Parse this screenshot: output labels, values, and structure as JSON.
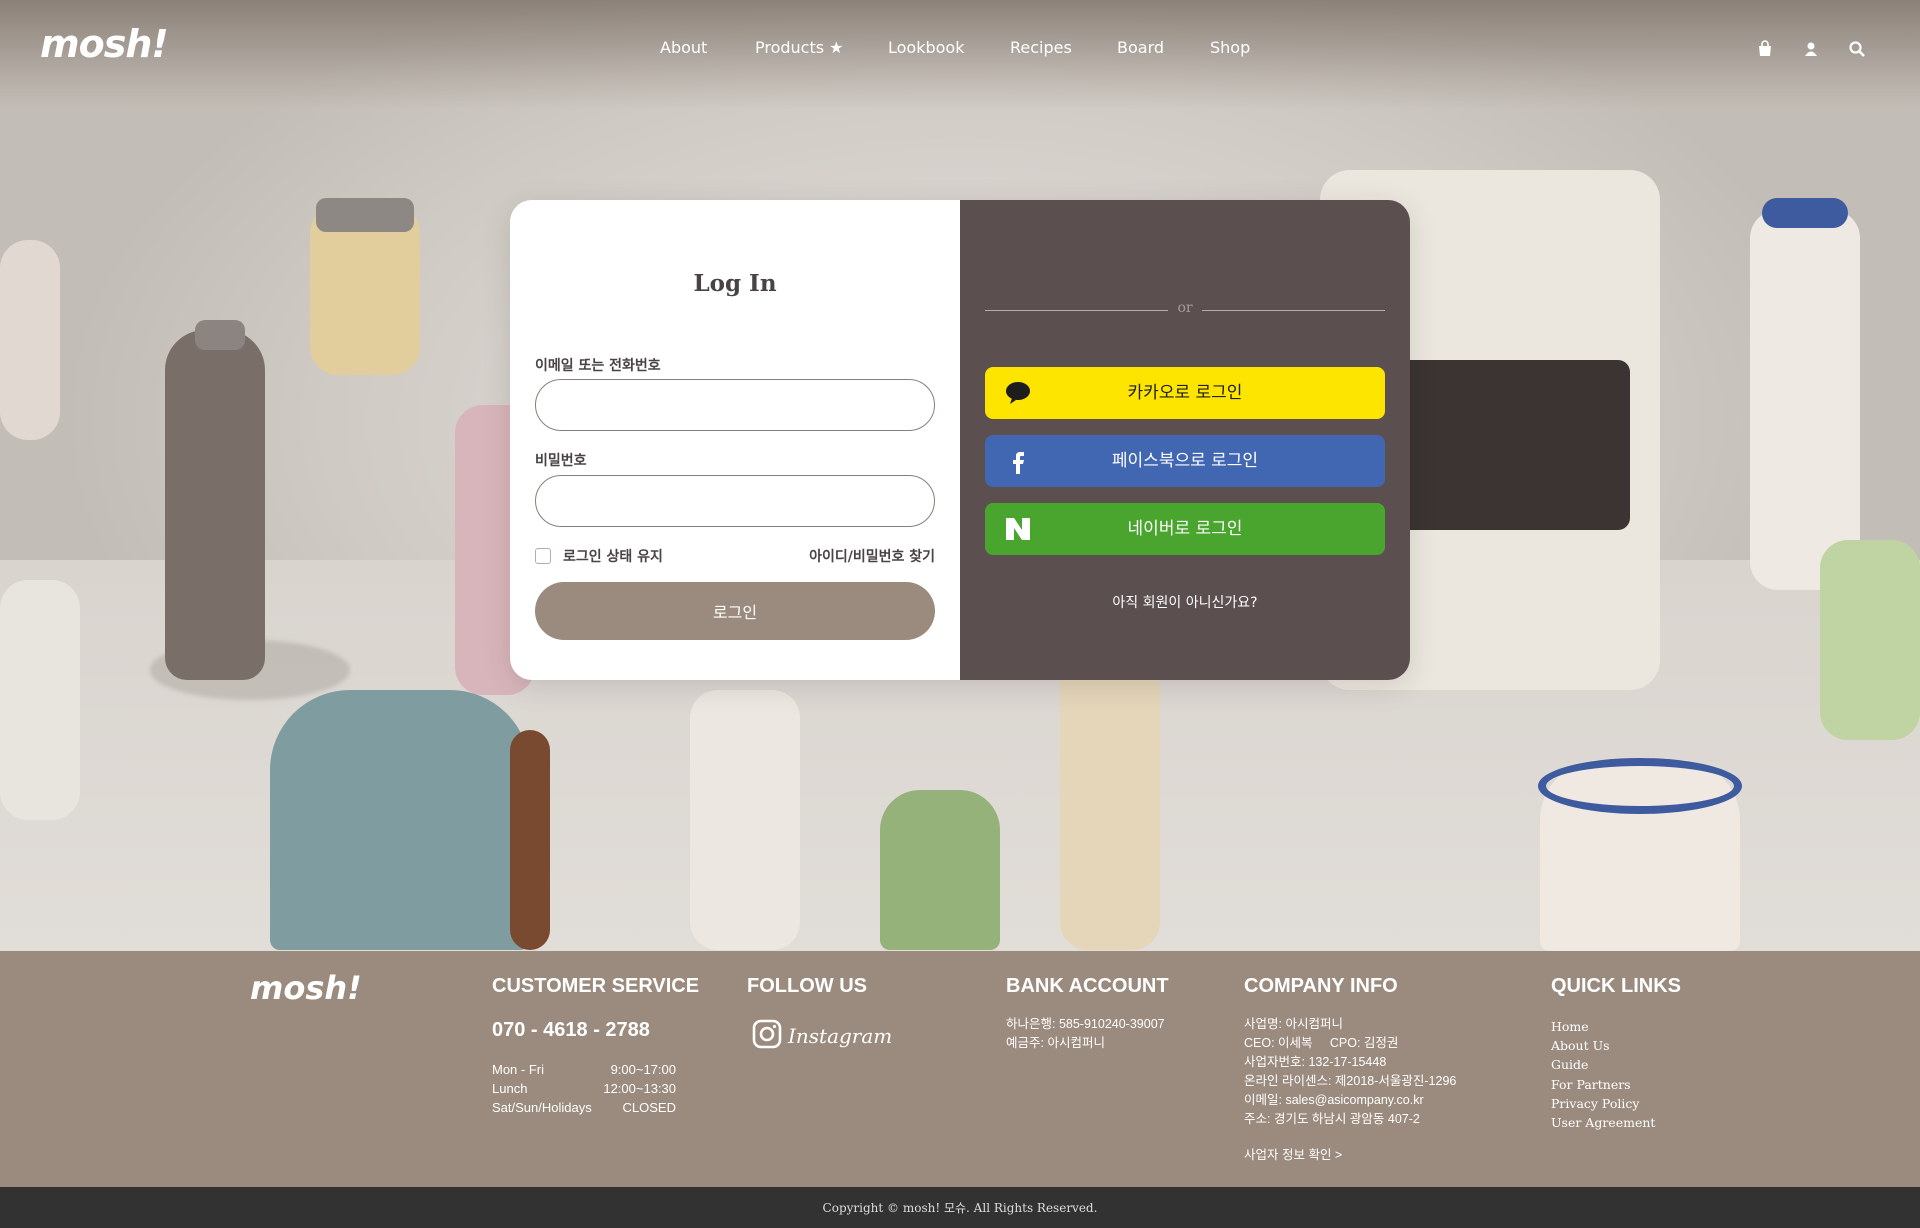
{
  "header": {
    "logo": "mosh!",
    "nav": [
      {
        "label": "About"
      },
      {
        "label": "Products ★"
      },
      {
        "label": "Lookbook"
      },
      {
        "label": "Recipes"
      },
      {
        "label": "Board"
      },
      {
        "label": "Shop"
      }
    ],
    "icons": [
      "shopping-bag-icon",
      "user-icon",
      "search-icon"
    ]
  },
  "login": {
    "title": "Log In",
    "id_label": "이메일 또는 전화번호",
    "id_value": "",
    "password_label": "비밀번호",
    "password_value": "",
    "remember_label": "로그인 상태 유지",
    "remember_checked": false,
    "find_link": "아이디/비밀번호 찾기",
    "submit_label": "로그인"
  },
  "social": {
    "or_text": "or",
    "kakao_label": "카카오로 로그인",
    "facebook_label": "페이스북으로 로그인",
    "naver_label": "네이버로 로그인",
    "signup_text": "아직 회원이 아니신가요?"
  },
  "footer": {
    "logo": "mosh!",
    "customer_service": {
      "heading": "CUSTOMER SERVICE",
      "phone": "070 - 4618 - 2788",
      "hours": [
        {
          "day": "Mon - Fri",
          "time": "9:00~17:00"
        },
        {
          "day": "Lunch",
          "time": "12:00~13:30"
        },
        {
          "day": "Sat/Sun/Holidays",
          "time": "CLOSED"
        }
      ]
    },
    "follow": {
      "heading": "FOLLOW US",
      "instagram": "Instagram"
    },
    "bank": {
      "heading": "BANK ACCOUNT",
      "lines": [
        "하나은행: 585-910240-39007",
        "예금주: 아시컴퍼니"
      ]
    },
    "company": {
      "heading": "COMPANY INFO",
      "lines": [
        "사업명: 아시컴퍼니",
        "CEO: 이세복     CPO: 김정권",
        "사업자번호: 132-17-15448",
        "온라인 라이센스: 제2018-서울광진-1296",
        "이메일: sales@asicompany.co.kr",
        "주소: 경기도 하남시 광암동 407-2"
      ],
      "link": "사업자 정보 확인 >"
    },
    "quick": {
      "heading": "QUICK LINKS",
      "links": [
        "Home",
        "About Us",
        "Guide",
        "For Partners",
        "Privacy Policy",
        "User Agreement"
      ]
    },
    "copyright": "Copyright © mosh! 모슈. All Rights Reserved."
  },
  "colors": {
    "card_right": "#5b4f4f",
    "login_button": "#9b8b7e",
    "kakao": "#fee500",
    "facebook": "#4267b2",
    "naver": "#4aa52e",
    "footer": "#9b8b7e",
    "copyright_bar": "#323232"
  }
}
